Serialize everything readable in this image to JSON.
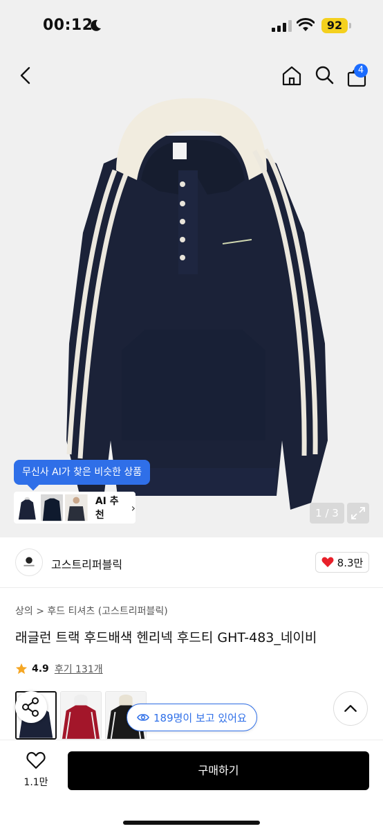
{
  "status_bar": {
    "time": "00:12",
    "battery": "92"
  },
  "header": {
    "cart_count": "4"
  },
  "ai": {
    "bubble_text": "무신사 AI가 찾은 비슷한 상품",
    "recommend_label": "AI 추천",
    "chevron": "›"
  },
  "gallery": {
    "page_indicator": "1 / 3"
  },
  "brand": {
    "name": "고스트리퍼블릭",
    "likes": "8.3만"
  },
  "product": {
    "breadcrumb": "상의 > 후드 티셔츠 (고스트리퍼블릭)",
    "title": "래글런 트랙 후드배색 헨리넥 후드티 GHT-483_네이비",
    "rating": "4.9",
    "reviews": "후기 131개",
    "viewers": "189명이 보고 있어요"
  },
  "bottom": {
    "wish_count": "1.1만",
    "buy_label": "구매하기"
  },
  "colors": {
    "accent": "#2f6fe8",
    "navy": "#1b2238",
    "like": "#e8202a",
    "star": "#f5a623"
  }
}
